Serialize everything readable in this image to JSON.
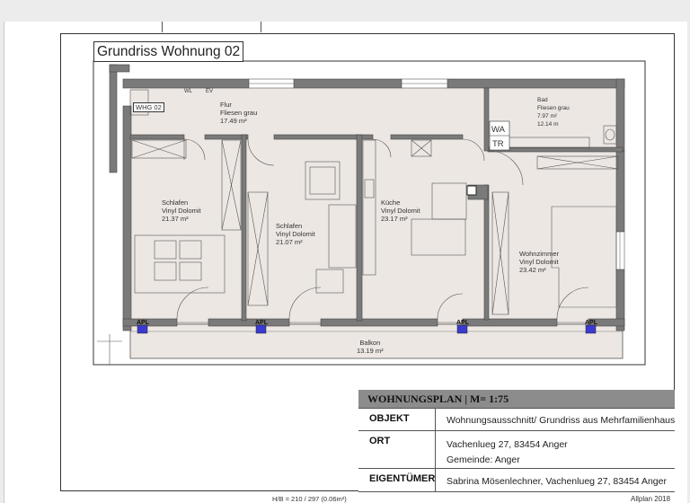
{
  "title": "Grundriss Wohnung 02",
  "unit_tag": "WHG 02",
  "rooms": [
    {
      "name": "Flur",
      "floor": "Fliesen grau",
      "area": "17.49 m²"
    },
    {
      "name": "Bad",
      "floor": "Fliesen grau",
      "area": "7.97 m²",
      "perimeter": "12.14 m"
    },
    {
      "name": "Schlafen",
      "floor": "Vinyl Dolomit",
      "area": "21.37 m²"
    },
    {
      "name": "Schlafen",
      "floor": "Vinyl Dolomit",
      "area": "21.07 m²"
    },
    {
      "name": "Küche",
      "floor": "Vinyl Dolomit",
      "area": "23.17 m²"
    },
    {
      "name": "Wohnzimmer",
      "floor": "Vinyl Dolomit",
      "area": "23.42 m²"
    },
    {
      "name": "Balkon",
      "area": "13.19 m²"
    }
  ],
  "labels": {
    "wa": "WA",
    "tr": "TR",
    "apl": "APL",
    "wl": "WL",
    "ev": "EV"
  },
  "title_block": {
    "header": "WOHNUNGSPLAN | M= 1:75",
    "rows": [
      {
        "key": "OBJEKT",
        "value": "Wohnungsausschnitt/ Grundriss aus Mehrfamilienhaus"
      },
      {
        "key": "ORT",
        "value": "Vachenlueg 27, 83454 Anger",
        "value2": "Gemeinde: Anger"
      },
      {
        "key": "EIGENTÜMER",
        "value": "Sabrina Mösenlechner, Vachenlueg 27, 83454 Anger"
      }
    ]
  },
  "footer": {
    "scale_note": "H/B = 210 / 297 (0.06m²)",
    "software": "Allplan 2018"
  },
  "colors": {
    "wall": "#7a7a7a",
    "apl": "#3b3bd0",
    "titlebar": "#8c8c8c"
  }
}
